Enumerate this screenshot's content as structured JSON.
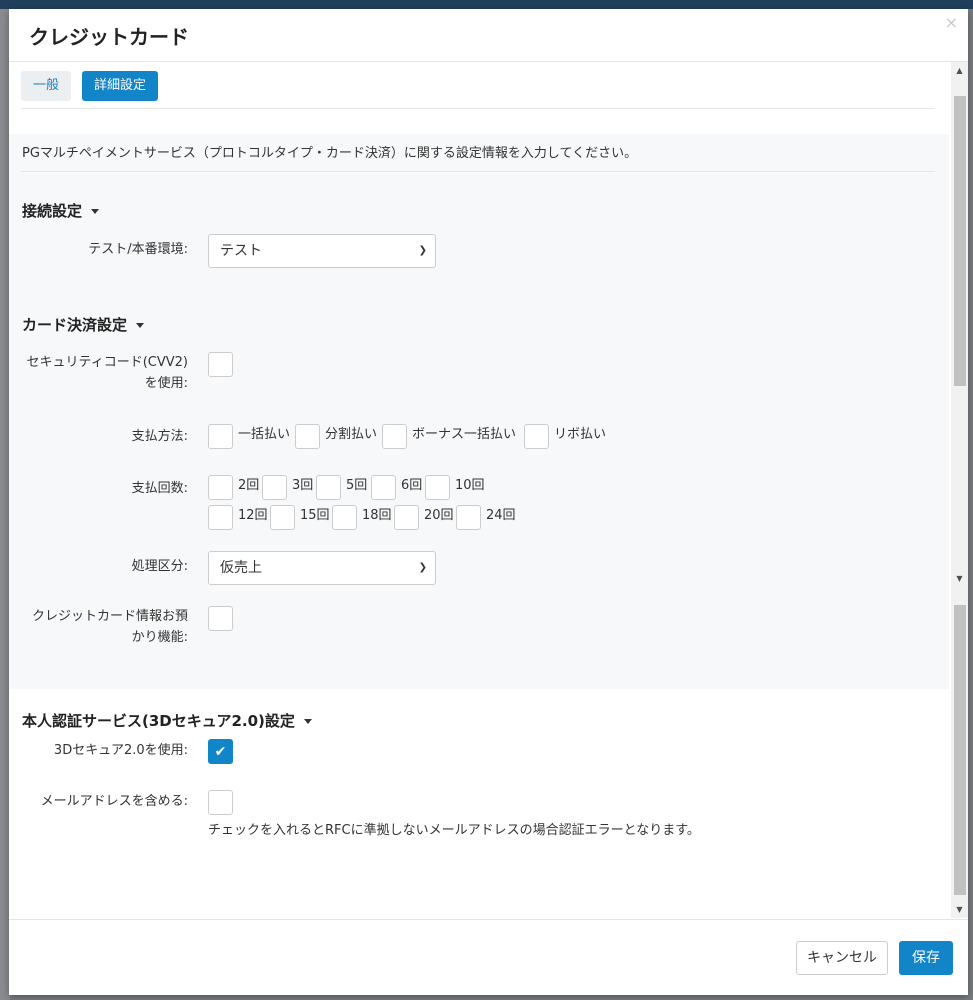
{
  "modal": {
    "title": "クレジットカード",
    "close_symbol": "×"
  },
  "tabs": [
    {
      "label": "一般"
    },
    {
      "label": "詳細設定"
    }
  ],
  "description": "PGマルチペイメントサービス（プロトコルタイプ・カード決済）に関する設定情報を入力してください。",
  "connection": {
    "title": "接続設定",
    "env_label": "テスト/本番環境:",
    "env_value": "テスト"
  },
  "card": {
    "title": "カード決済設定",
    "security_label_1": "セキュリティコード(CVV2)",
    "security_label_2": "を使用:",
    "payment_method_label": "支払方法:",
    "payment_methods": [
      "一括払い",
      "分割払い",
      "ボーナス一括払い",
      "リボ払い"
    ],
    "installments_label": "支払回数:",
    "installments_row1": [
      "2回",
      "3回",
      "5回",
      "6回",
      "10回"
    ],
    "installments_row2": [
      "12回",
      "15回",
      "18回",
      "20回",
      "24回"
    ],
    "processing_label": "処理区分:",
    "processing_value": "仮売上",
    "deposit_label_1": "クレジットカード情報お預",
    "deposit_label_2": "かり機能:"
  },
  "three_d": {
    "title": "本人認証サービス(3Dセキュア2.0)設定",
    "use_label": "3Dセキュア2.0を使用:",
    "use_checked": true,
    "email_label": "メールアドレスを含める:",
    "email_checked": false,
    "note": "チェックを入れるとRFCに準拠しないメールアドレスの場合認証エラーとなります。"
  },
  "footer": {
    "cancel_label": "キャンセル",
    "save_label": "保存"
  },
  "colors": {
    "accent": "#1185c8",
    "header_bar": "#1f3f5c"
  }
}
